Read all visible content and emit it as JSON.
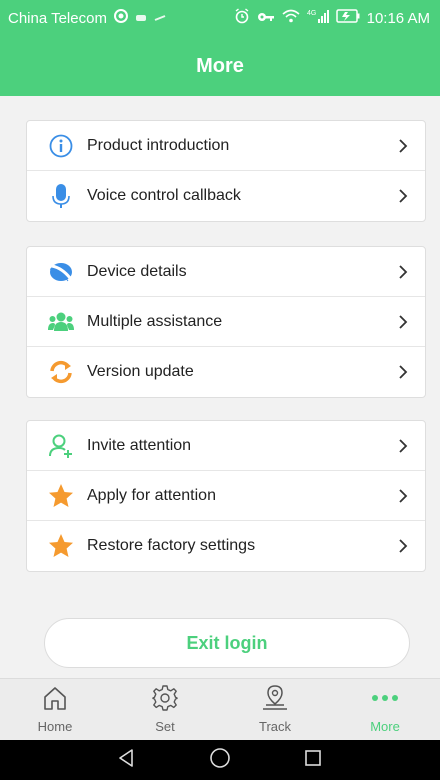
{
  "status_bar": {
    "carrier": "China Telecom",
    "network": "4G",
    "time": "10:16 AM"
  },
  "header": {
    "title": "More"
  },
  "groups": [
    {
      "items": [
        {
          "label": "Product introduction",
          "icon": "info-icon"
        },
        {
          "label": "Voice control callback",
          "icon": "microphone-icon"
        }
      ]
    },
    {
      "items": [
        {
          "label": "Device details",
          "icon": "device-icon"
        },
        {
          "label": "Multiple assistance",
          "icon": "people-icon"
        },
        {
          "label": "Version update",
          "icon": "refresh-icon"
        }
      ]
    },
    {
      "items": [
        {
          "label": "Invite attention",
          "icon": "add-user-icon"
        },
        {
          "label": "Apply for attention",
          "icon": "star-icon"
        },
        {
          "label": "Restore factory settings",
          "icon": "star-icon"
        }
      ]
    }
  ],
  "exit_button": {
    "label": "Exit login"
  },
  "tabs": [
    {
      "label": "Home",
      "icon": "home-icon"
    },
    {
      "label": "Set",
      "icon": "gear-icon"
    },
    {
      "label": "Track",
      "icon": "location-pin-icon"
    },
    {
      "label": "More",
      "icon": "more-dots-icon",
      "active": true
    }
  ],
  "colors": {
    "accent": "#4cd07d",
    "blue": "#3a8ee6",
    "orange": "#f59a2f",
    "background": "#f2f2f2"
  }
}
